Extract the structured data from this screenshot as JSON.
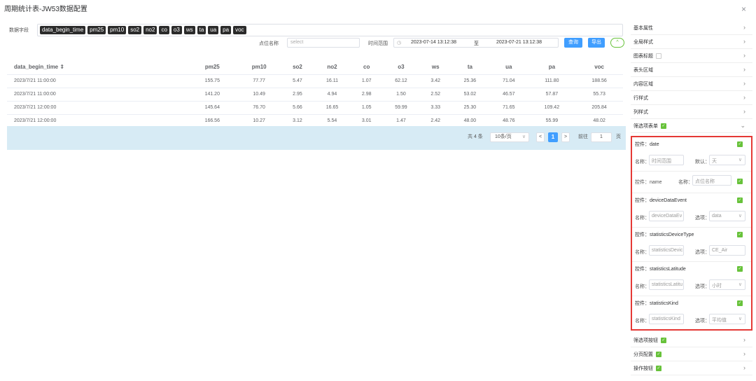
{
  "dialog": {
    "title": "周期统计表-JW53数据配置",
    "close_icon": "×"
  },
  "fields": {
    "label": "数据字段",
    "tags": [
      "data_begin_time",
      "pm25",
      "pm10",
      "so2",
      "no2",
      "co",
      "o3",
      "ws",
      "ta",
      "ua",
      "pa",
      "voc"
    ]
  },
  "filter": {
    "point_label": "点位名称",
    "point_placeholder": "select",
    "time_label": "时间范围",
    "start": "2023-07-14 13:12:38",
    "sep": "至",
    "end": "2023-07-21 13:12:38",
    "query": "查询",
    "export": "导出",
    "toggle": "^"
  },
  "table": {
    "sort_icon": "⇕",
    "columns": [
      "data_begin_time",
      "pm25",
      "pm10",
      "so2",
      "no2",
      "co",
      "o3",
      "ws",
      "ta",
      "ua",
      "pa",
      "voc"
    ],
    "rows": [
      [
        "2023/7/21 11:00:00",
        "155.75",
        "77.77",
        "5.47",
        "16.11",
        "1.07",
        "62.12",
        "3.42",
        "25.36",
        "71.04",
        "111.80",
        "188.56"
      ],
      [
        "2023/7/21 11:00:00",
        "141.20",
        "10.49",
        "2.95",
        "4.94",
        "2.98",
        "1.50",
        "2.52",
        "53.02",
        "46.57",
        "57.87",
        "55.73"
      ],
      [
        "2023/7/21 12:00:00",
        "145.64",
        "76.70",
        "5.66",
        "16.65",
        "1.05",
        "59.99",
        "3.33",
        "25.30",
        "71.65",
        "109.42",
        "205.84"
      ],
      [
        "2023/7/21 12:00:00",
        "166.56",
        "10.27",
        "3.12",
        "5.54",
        "3.01",
        "1.47",
        "2.42",
        "48.00",
        "48.76",
        "55.99",
        "48.02"
      ]
    ]
  },
  "pager": {
    "total": "共 4 条",
    "page_size": "10条/页",
    "prev": "<",
    "current": "1",
    "next": ">",
    "goto": "前往",
    "goto_value": "1",
    "page_unit": "页"
  },
  "panel": {
    "sections_top": [
      "基本属性",
      "全局样式",
      "图表标题",
      "表头区域",
      "内容区域",
      "行样式",
      "列样式",
      "筛选项表单"
    ],
    "controls": {
      "date": {
        "head": "控件：date",
        "name_label": "名称：",
        "name_value": "时间范围",
        "opt_label": "默认：",
        "opt_value": "天"
      },
      "name": {
        "head": "控件：name",
        "name_label": "名称：",
        "name_value": "点位名称"
      },
      "deviceDataEvent": {
        "head": "控件：deviceDataEvent",
        "name_label": "名称：",
        "name_value": "deviceDataEv",
        "opt_label": "选项：",
        "opt_value": "data"
      },
      "statisticsDeviceType": {
        "head": "控件：statisticsDeviceType",
        "name_label": "名称：",
        "name_value": "statisticsDevic",
        "opt_label": "选项：",
        "opt_value": "CE_Air"
      },
      "statisticsLatitude": {
        "head": "控件：statisticsLatitude",
        "name_label": "名称：",
        "name_value": "statisticsLatitu",
        "opt_label": "选项：",
        "opt_value": "小时"
      },
      "statisticsKind": {
        "head": "控件：statisticsKind",
        "name_label": "名称：",
        "name_value": "statisticsKind",
        "opt_label": "选项：",
        "opt_value": "平均值"
      }
    },
    "sections_bottom": [
      "筛选项按钮",
      "分页配置",
      "操作按钮"
    ],
    "chevron_right": "›",
    "chevron_down": "⌄",
    "dropdown": "∨",
    "check": "✓"
  },
  "colors": {
    "accent": "#409eff",
    "check": "#67c23a",
    "highlight": "#e53935",
    "pager_bg": "#d7ebf5"
  }
}
